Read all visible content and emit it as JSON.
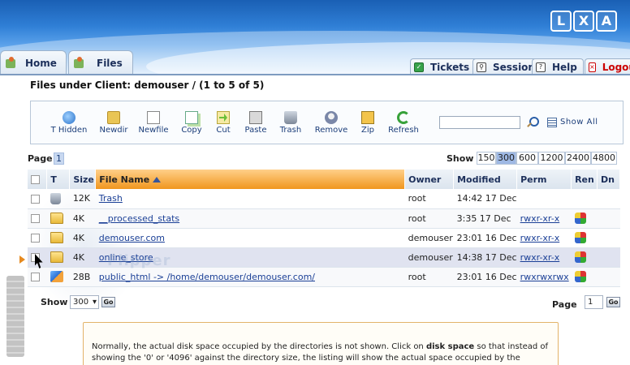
{
  "header": {
    "logo": "LXA",
    "tabs": [
      {
        "label": "Home",
        "icon": "home-tab-icon"
      },
      {
        "label": "Files",
        "icon": "files-tab-icon"
      }
    ],
    "right_tabs": [
      {
        "label": "Tickets",
        "icon": "tickets-icon"
      },
      {
        "label": "Session",
        "icon": "session-icon"
      },
      {
        "label": "Help",
        "icon": "help-icon"
      },
      {
        "label": "Logout",
        "icon": "logout-icon"
      }
    ]
  },
  "page_title": "Files under Client: demouser / (1 to 5 of 5)",
  "toolbar": {
    "buttons": [
      {
        "label": "T Hidden",
        "icon": "toggle-hidden-icon"
      },
      {
        "label": "Newdir",
        "icon": "new-directory-icon"
      },
      {
        "label": "Newfile",
        "icon": "new-file-icon"
      },
      {
        "label": "Copy",
        "icon": "copy-icon"
      },
      {
        "label": "Cut",
        "icon": "cut-icon"
      },
      {
        "label": "Paste",
        "icon": "paste-icon"
      },
      {
        "label": "Trash",
        "icon": "trash-icon"
      },
      {
        "label": "Remove",
        "icon": "remove-icon"
      },
      {
        "label": "Zip",
        "icon": "zip-icon"
      },
      {
        "label": "Refresh",
        "icon": "refresh-icon"
      }
    ],
    "search_value": "",
    "show_all_label": "Show All"
  },
  "pagination": {
    "page_label": "Page",
    "current_page": "1",
    "show_label": "Show",
    "show_options": [
      "150",
      "300",
      "600",
      "1200",
      "2400",
      "4800"
    ],
    "show_selected": "300"
  },
  "table": {
    "headers": {
      "type": "T",
      "size": "Size",
      "name": "File Name",
      "owner": "Owner",
      "modified": "Modified",
      "perm": "Perm",
      "ren": "Ren",
      "dn": "Dn"
    },
    "rows": [
      {
        "type": "trash",
        "size": "12K",
        "name": "Trash",
        "owner": "root",
        "modified": "14:42 17 Dec",
        "perm": ""
      },
      {
        "type": "folder",
        "size": "4K",
        "name": "__processed_stats",
        "owner": "root",
        "modified": "3:35 17 Dec",
        "perm": "rwxr-xr-x"
      },
      {
        "type": "folder",
        "size": "4K",
        "name": "demouser.com",
        "owner": "demouser",
        "modified": "23:01 16 Dec",
        "perm": "rwxr-xr-x"
      },
      {
        "type": "folder",
        "size": "4K",
        "name": "online_store",
        "owner": "demouser",
        "modified": "14:38 17 Dec",
        "perm": "rwxr-xr-x"
      },
      {
        "type": "link",
        "size": "28B",
        "name": "public_html -> /home/demouser/demouser.com/",
        "owner": "root",
        "modified": "23:01 16 Dec",
        "perm": "rwxrwxrwx"
      }
    ]
  },
  "footer": {
    "show_label": "Show",
    "show_value": "300",
    "go_label": "Go",
    "page_label": "Page",
    "page_value": "1"
  },
  "note": {
    "text_before": "Normally, the actual disk space occupied by the directories is not shown. Click on ",
    "bold": "disk space",
    "text_after": " so that instead of showing the '0' or '4096' against the directory size, the listing will show the actual space occupied by the directories."
  },
  "watermark": "Flipper"
}
